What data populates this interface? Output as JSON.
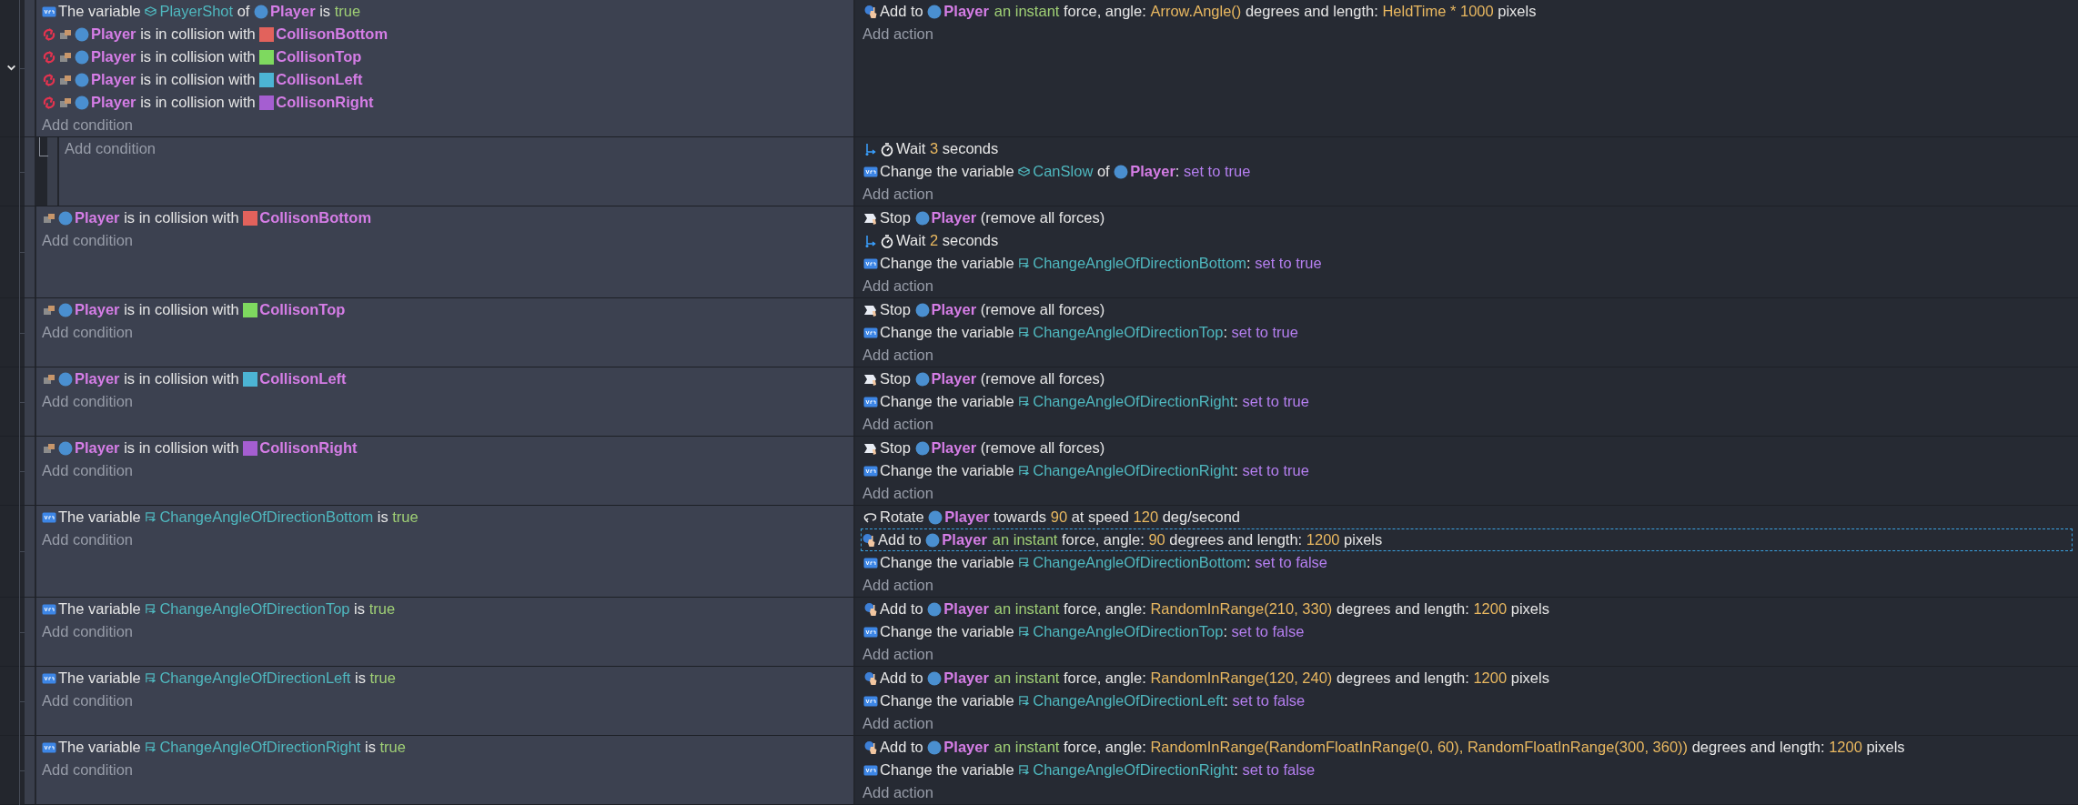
{
  "events": [
    {
      "expanded": true,
      "add_condition": "Add condition",
      "add_action": "Add action",
      "conditions": [
        {
          "kind": "variable",
          "inverted": false,
          "parts": [
            {
              "kind": "text",
              "text": "The variable "
            },
            {
              "kind": "objvar",
              "text": "PlayerShot"
            },
            {
              "kind": "text",
              "text": " of "
            },
            {
              "kind": "sprite",
              "text": "Player",
              "color": "#4a8fd0"
            },
            {
              "kind": "text",
              "text": " is "
            },
            {
              "kind": "keyword",
              "text": "true"
            }
          ]
        },
        {
          "kind": "collision",
          "inverted": true,
          "parts": [
            {
              "kind": "sprite",
              "text": "Player",
              "color": "#4a8fd0"
            },
            {
              "kind": "text",
              "text": " is in collision with "
            },
            {
              "kind": "tile",
              "text": "CollisonBottom",
              "color": "#e2625c"
            }
          ]
        },
        {
          "kind": "collision",
          "inverted": true,
          "parts": [
            {
              "kind": "sprite",
              "text": "Player",
              "color": "#4a8fd0"
            },
            {
              "kind": "text",
              "text": " is in collision with "
            },
            {
              "kind": "tile",
              "text": "CollisonTop",
              "color": "#7ed95f"
            }
          ]
        },
        {
          "kind": "collision",
          "inverted": true,
          "parts": [
            {
              "kind": "sprite",
              "text": "Player",
              "color": "#4a8fd0"
            },
            {
              "kind": "text",
              "text": " is in collision with "
            },
            {
              "kind": "tile",
              "text": "CollisonLeft",
              "color": "#4cb4d4"
            }
          ]
        },
        {
          "kind": "collision",
          "inverted": true,
          "parts": [
            {
              "kind": "sprite",
              "text": "Player",
              "color": "#4a8fd0"
            },
            {
              "kind": "text",
              "text": " is in collision with "
            },
            {
              "kind": "tile",
              "text": "CollisonRight",
              "color": "#a55ed1"
            }
          ]
        }
      ],
      "actions": [
        {
          "kind": "force",
          "selected": false,
          "parts": [
            {
              "kind": "text",
              "text": "Add to "
            },
            {
              "kind": "sprite",
              "text": "Player",
              "color": "#4a8fd0"
            },
            {
              "kind": "keyword",
              "text": "an instant"
            },
            {
              "kind": "text",
              "text": " force, angle: "
            },
            {
              "kind": "expr",
              "text": "Arrow.Angle()"
            },
            {
              "kind": "text",
              "text": " degrees and length: "
            },
            {
              "kind": "expr",
              "text": "HeldTime * 1000"
            },
            {
              "kind": "text",
              "text": " pixels"
            }
          ]
        }
      ],
      "children": [
        {
          "add_condition": "Add condition",
          "add_action": "Add action",
          "actions": [
            {
              "kind": "wait",
              "selected": false,
              "parts": [
                {
                  "kind": "text",
                  "text": "Wait "
                },
                {
                  "kind": "expr",
                  "text": "3"
                },
                {
                  "kind": "text",
                  "text": " seconds"
                }
              ]
            },
            {
              "kind": "variable",
              "selected": false,
              "parts": [
                {
                  "kind": "text",
                  "text": "Change the variable "
                },
                {
                  "kind": "objvar",
                  "text": "CanSlow"
                },
                {
                  "kind": "text",
                  "text": " of "
                },
                {
                  "kind": "sprite",
                  "text": "Player",
                  "color": "#4a8fd0"
                },
                {
                  "kind": "text",
                  "text": ": "
                },
                {
                  "kind": "set",
                  "text": "set to true"
                }
              ]
            }
          ]
        }
      ]
    },
    {
      "add_condition": "Add condition",
      "add_action": "Add action",
      "conditions": [
        {
          "kind": "collision",
          "inverted": false,
          "parts": [
            {
              "kind": "sprite",
              "text": "Player",
              "color": "#4a8fd0"
            },
            {
              "kind": "text",
              "text": " is in collision with "
            },
            {
              "kind": "tile",
              "text": "CollisonBottom",
              "color": "#e2625c"
            }
          ]
        }
      ],
      "actions": [
        {
          "kind": "stop",
          "selected": false,
          "parts": [
            {
              "kind": "text",
              "text": "Stop "
            },
            {
              "kind": "sprite",
              "text": "Player",
              "color": "#4a8fd0"
            },
            {
              "kind": "text",
              "text": " (remove all forces)"
            }
          ]
        },
        {
          "kind": "wait",
          "selected": false,
          "parts": [
            {
              "kind": "text",
              "text": "Wait "
            },
            {
              "kind": "expr",
              "text": "2"
            },
            {
              "kind": "text",
              "text": " seconds"
            }
          ]
        },
        {
          "kind": "variable",
          "selected": false,
          "parts": [
            {
              "kind": "text",
              "text": "Change the variable "
            },
            {
              "kind": "scenevar",
              "text": "ChangeAngleOfDirectionBottom"
            },
            {
              "kind": "text",
              "text": ": "
            },
            {
              "kind": "set",
              "text": "set to true"
            }
          ]
        }
      ]
    },
    {
      "add_condition": "Add condition",
      "add_action": "Add action",
      "conditions": [
        {
          "kind": "collision",
          "inverted": false,
          "parts": [
            {
              "kind": "sprite",
              "text": "Player",
              "color": "#4a8fd0"
            },
            {
              "kind": "text",
              "text": " is in collision with "
            },
            {
              "kind": "tile",
              "text": "CollisonTop",
              "color": "#7ed95f"
            }
          ]
        }
      ],
      "actions": [
        {
          "kind": "stop",
          "selected": false,
          "parts": [
            {
              "kind": "text",
              "text": "Stop "
            },
            {
              "kind": "sprite",
              "text": "Player",
              "color": "#4a8fd0"
            },
            {
              "kind": "text",
              "text": " (remove all forces)"
            }
          ]
        },
        {
          "kind": "variable",
          "selected": false,
          "parts": [
            {
              "kind": "text",
              "text": "Change the variable "
            },
            {
              "kind": "scenevar",
              "text": "ChangeAngleOfDirectionTop"
            },
            {
              "kind": "text",
              "text": ": "
            },
            {
              "kind": "set",
              "text": "set to true"
            }
          ]
        }
      ]
    },
    {
      "add_condition": "Add condition",
      "add_action": "Add action",
      "conditions": [
        {
          "kind": "collision",
          "inverted": false,
          "parts": [
            {
              "kind": "sprite",
              "text": "Player",
              "color": "#4a8fd0"
            },
            {
              "kind": "text",
              "text": " is in collision with "
            },
            {
              "kind": "tile",
              "text": "CollisonLeft",
              "color": "#4cb4d4"
            }
          ]
        }
      ],
      "actions": [
        {
          "kind": "stop",
          "selected": false,
          "parts": [
            {
              "kind": "text",
              "text": "Stop "
            },
            {
              "kind": "sprite",
              "text": "Player",
              "color": "#4a8fd0"
            },
            {
              "kind": "text",
              "text": " (remove all forces)"
            }
          ]
        },
        {
          "kind": "variable",
          "selected": false,
          "parts": [
            {
              "kind": "text",
              "text": "Change the variable "
            },
            {
              "kind": "scenevar",
              "text": "ChangeAngleOfDirectionRight"
            },
            {
              "kind": "text",
              "text": ": "
            },
            {
              "kind": "set",
              "text": "set to true"
            }
          ]
        }
      ]
    },
    {
      "add_condition": "Add condition",
      "add_action": "Add action",
      "conditions": [
        {
          "kind": "collision",
          "inverted": false,
          "parts": [
            {
              "kind": "sprite",
              "text": "Player",
              "color": "#4a8fd0"
            },
            {
              "kind": "text",
              "text": " is in collision with "
            },
            {
              "kind": "tile",
              "text": "CollisonRight",
              "color": "#a55ed1"
            }
          ]
        }
      ],
      "actions": [
        {
          "kind": "stop",
          "selected": false,
          "parts": [
            {
              "kind": "text",
              "text": "Stop "
            },
            {
              "kind": "sprite",
              "text": "Player",
              "color": "#4a8fd0"
            },
            {
              "kind": "text",
              "text": " (remove all forces)"
            }
          ]
        },
        {
          "kind": "variable",
          "selected": false,
          "parts": [
            {
              "kind": "text",
              "text": "Change the variable "
            },
            {
              "kind": "scenevar",
              "text": "ChangeAngleOfDirectionRight"
            },
            {
              "kind": "text",
              "text": ": "
            },
            {
              "kind": "set",
              "text": "set to true"
            }
          ]
        }
      ]
    },
    {
      "add_condition": "Add condition",
      "add_action": "Add action",
      "conditions": [
        {
          "kind": "variable",
          "inverted": false,
          "parts": [
            {
              "kind": "text",
              "text": "The variable "
            },
            {
              "kind": "scenevar",
              "text": "ChangeAngleOfDirectionBottom"
            },
            {
              "kind": "text",
              "text": " is "
            },
            {
              "kind": "keyword",
              "text": "true"
            }
          ]
        }
      ],
      "actions": [
        {
          "kind": "rotate",
          "selected": false,
          "parts": [
            {
              "kind": "text",
              "text": "Rotate "
            },
            {
              "kind": "sprite",
              "text": "Player",
              "color": "#4a8fd0"
            },
            {
              "kind": "text",
              "text": " towards "
            },
            {
              "kind": "expr",
              "text": "90"
            },
            {
              "kind": "text",
              "text": " at speed "
            },
            {
              "kind": "expr",
              "text": "120"
            },
            {
              "kind": "text",
              "text": " deg/second"
            }
          ]
        },
        {
          "kind": "force",
          "selected": true,
          "parts": [
            {
              "kind": "text",
              "text": "Add to "
            },
            {
              "kind": "sprite",
              "text": "Player",
              "color": "#4a8fd0"
            },
            {
              "kind": "keyword",
              "text": "an instant"
            },
            {
              "kind": "text",
              "text": " force, angle: "
            },
            {
              "kind": "expr",
              "text": "90"
            },
            {
              "kind": "text",
              "text": " degrees and length: "
            },
            {
              "kind": "expr",
              "text": "1200"
            },
            {
              "kind": "text",
              "text": " pixels"
            }
          ]
        },
        {
          "kind": "variable",
          "selected": false,
          "parts": [
            {
              "kind": "text",
              "text": "Change the variable "
            },
            {
              "kind": "scenevar",
              "text": "ChangeAngleOfDirectionBottom"
            },
            {
              "kind": "text",
              "text": ": "
            },
            {
              "kind": "set",
              "text": "set to false"
            }
          ]
        }
      ]
    },
    {
      "add_condition": "Add condition",
      "add_action": "Add action",
      "conditions": [
        {
          "kind": "variable",
          "inverted": false,
          "parts": [
            {
              "kind": "text",
              "text": "The variable "
            },
            {
              "kind": "scenevar",
              "text": "ChangeAngleOfDirectionTop"
            },
            {
              "kind": "text",
              "text": " is "
            },
            {
              "kind": "keyword",
              "text": "true"
            }
          ]
        }
      ],
      "actions": [
        {
          "kind": "force",
          "selected": false,
          "parts": [
            {
              "kind": "text",
              "text": "Add to "
            },
            {
              "kind": "sprite",
              "text": "Player",
              "color": "#4a8fd0"
            },
            {
              "kind": "keyword",
              "text": "an instant"
            },
            {
              "kind": "text",
              "text": " force, angle: "
            },
            {
              "kind": "expr",
              "text": "RandomInRange(210, 330)"
            },
            {
              "kind": "text",
              "text": " degrees and length: "
            },
            {
              "kind": "expr",
              "text": "1200"
            },
            {
              "kind": "text",
              "text": " pixels"
            }
          ]
        },
        {
          "kind": "variable",
          "selected": false,
          "parts": [
            {
              "kind": "text",
              "text": "Change the variable "
            },
            {
              "kind": "scenevar",
              "text": "ChangeAngleOfDirectionTop"
            },
            {
              "kind": "text",
              "text": ": "
            },
            {
              "kind": "set",
              "text": "set to false"
            }
          ]
        }
      ]
    },
    {
      "add_condition": "Add condition",
      "add_action": "Add action",
      "conditions": [
        {
          "kind": "variable",
          "inverted": false,
          "parts": [
            {
              "kind": "text",
              "text": "The variable "
            },
            {
              "kind": "scenevar",
              "text": "ChangeAngleOfDirectionLeft"
            },
            {
              "kind": "text",
              "text": " is "
            },
            {
              "kind": "keyword",
              "text": "true"
            }
          ]
        }
      ],
      "actions": [
        {
          "kind": "force",
          "selected": false,
          "parts": [
            {
              "kind": "text",
              "text": "Add to "
            },
            {
              "kind": "sprite",
              "text": "Player",
              "color": "#4a8fd0"
            },
            {
              "kind": "keyword",
              "text": "an instant"
            },
            {
              "kind": "text",
              "text": " force, angle: "
            },
            {
              "kind": "expr",
              "text": "RandomInRange(120, 240)"
            },
            {
              "kind": "text",
              "text": " degrees and length: "
            },
            {
              "kind": "expr",
              "text": "1200"
            },
            {
              "kind": "text",
              "text": " pixels"
            }
          ]
        },
        {
          "kind": "variable",
          "selected": false,
          "parts": [
            {
              "kind": "text",
              "text": "Change the variable "
            },
            {
              "kind": "scenevar",
              "text": "ChangeAngleOfDirectionLeft"
            },
            {
              "kind": "text",
              "text": ": "
            },
            {
              "kind": "set",
              "text": "set to false"
            }
          ]
        }
      ]
    },
    {
      "add_condition": "Add condition",
      "add_action": "Add action",
      "conditions": [
        {
          "kind": "variable",
          "inverted": false,
          "parts": [
            {
              "kind": "text",
              "text": "The variable "
            },
            {
              "kind": "scenevar",
              "text": "ChangeAngleOfDirectionRight"
            },
            {
              "kind": "text",
              "text": " is "
            },
            {
              "kind": "keyword",
              "text": "true"
            }
          ]
        }
      ],
      "actions": [
        {
          "kind": "force",
          "selected": false,
          "parts": [
            {
              "kind": "text",
              "text": "Add to "
            },
            {
              "kind": "sprite",
              "text": "Player",
              "color": "#4a8fd0"
            },
            {
              "kind": "keyword",
              "text": "an instant"
            },
            {
              "kind": "text",
              "text": " force, angle: "
            },
            {
              "kind": "expr",
              "text": "RandomInRange(RandomFloatInRange(0, 60), RandomFloatInRange(300, 360))"
            },
            {
              "kind": "text",
              "text": " degrees and length: "
            },
            {
              "kind": "expr",
              "text": "1200"
            },
            {
              "kind": "text",
              "text": " pixels"
            }
          ]
        },
        {
          "kind": "variable",
          "selected": false,
          "parts": [
            {
              "kind": "text",
              "text": "Change the variable "
            },
            {
              "kind": "scenevar",
              "text": "ChangeAngleOfDirectionRight"
            },
            {
              "kind": "text",
              "text": ": "
            },
            {
              "kind": "set",
              "text": "set to false"
            }
          ]
        }
      ]
    }
  ]
}
